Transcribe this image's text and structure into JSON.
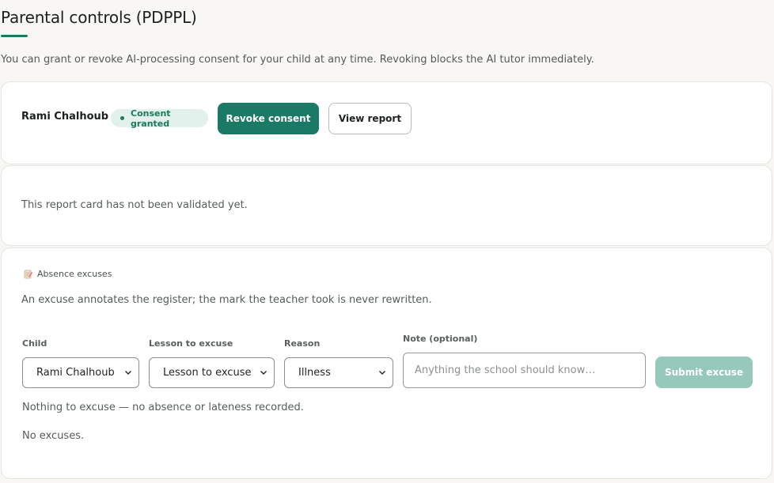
{
  "page": {
    "title": "Parental controls (PDPPL)",
    "intro": "You can grant or revoke AI-processing consent for your child at any time. Revoking blocks the AI tutor immediately."
  },
  "consent": {
    "child_name": "Rami Chalhoub",
    "status_badge": "Consent granted",
    "revoke_label": "Revoke consent",
    "view_report_label": "View report"
  },
  "report": {
    "message": "This report card has not been validated yet."
  },
  "absence": {
    "heading": "Absence excuses",
    "heading_icon": "memo-icon",
    "description": "An excuse annotates the register; the mark the teacher took is never rewritten.",
    "form": {
      "child_label": "Child",
      "child_value": "Rami Chalhoub",
      "lesson_label": "Lesson to excuse",
      "lesson_value": "Lesson to excuse",
      "reason_label": "Reason",
      "reason_value": "Illness",
      "note_label": "Note (optional)",
      "note_placeholder": "Anything the school should know…",
      "submit_label": "Submit excuse"
    },
    "empty_message": "Nothing to excuse — no absence or lateness recorded.",
    "no_excuses": "No excuses."
  },
  "colors": {
    "accent": "#1a7a66",
    "accent_disabled": "#97c9bb",
    "badge_bg": "#e3f1ec",
    "page_bg": "#f8f7f3"
  }
}
